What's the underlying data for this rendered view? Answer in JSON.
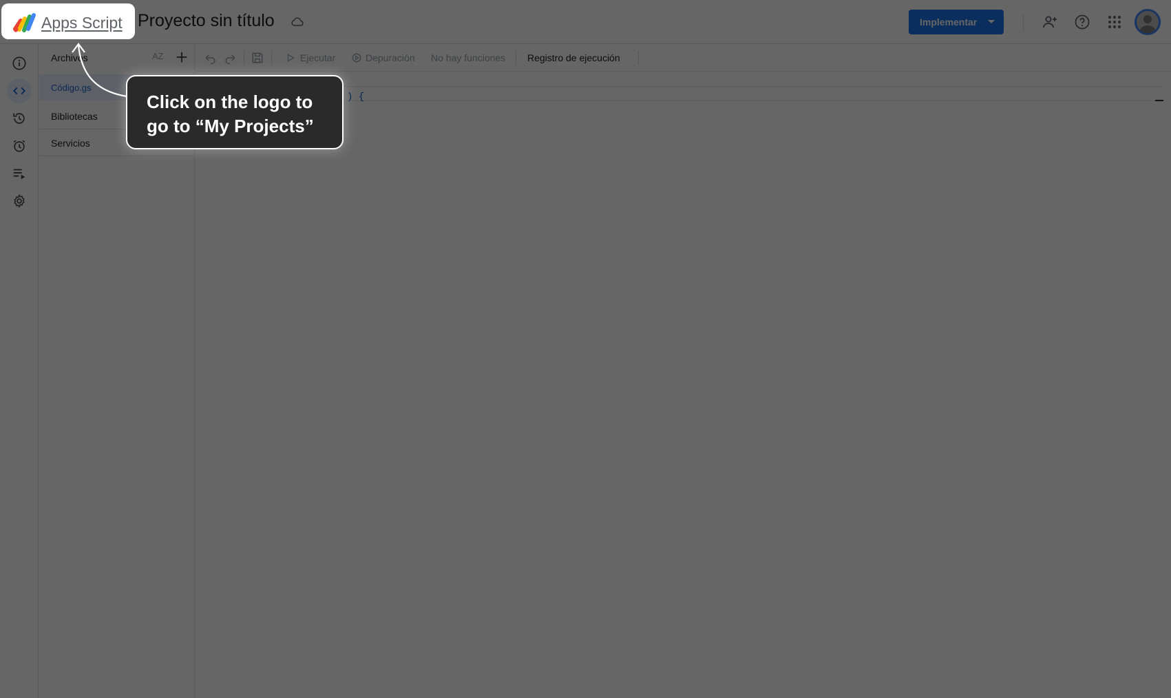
{
  "header": {
    "logo_text": "Apps Script",
    "project_title": "Proyecto sin título",
    "deploy_label": "Implementar"
  },
  "rail": {
    "items": [
      "info-icon",
      "code-icon",
      "history-icon",
      "alarm-icon",
      "executions-icon",
      "settings-icon"
    ],
    "active": "code-icon"
  },
  "files": {
    "title": "Archivos",
    "sort_label": "AZ",
    "items": [
      {
        "label": "Código.gs",
        "active": true
      }
    ],
    "libraries_label": "Bibliotecas",
    "services_label": "Servicios"
  },
  "toolbar": {
    "run_label": "Ejecutar",
    "debug_label": "Depuración",
    "function_select": "No hay funciones",
    "execution_log_label": "Registro de ejecución"
  },
  "editor": {
    "visible_code": ") {"
  },
  "coachmark": {
    "text": "Click on the logo to go to “My Projects”"
  },
  "colors": {
    "primary": "#1a73e8",
    "active_bg": "#e8f0fe",
    "active_text": "#1967d2",
    "overlay": "rgba(0,0,0,0.6)",
    "tooltip_bg": "#2a2a2a"
  }
}
